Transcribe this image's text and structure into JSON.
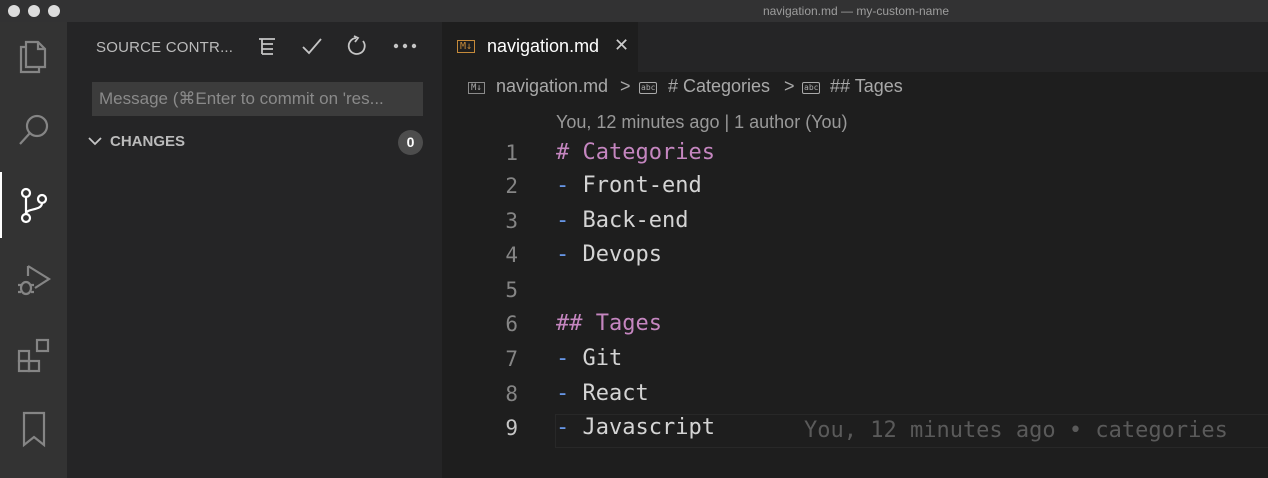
{
  "window": {
    "title": "navigation.md — my-custom-name"
  },
  "activity_bar": {
    "items": [
      {
        "icon": "files-icon"
      },
      {
        "icon": "search-icon"
      },
      {
        "icon": "source-control-icon",
        "active": true
      },
      {
        "icon": "run-debug-icon"
      },
      {
        "icon": "extensions-icon"
      },
      {
        "icon": "bookmark-icon"
      }
    ]
  },
  "sidebar": {
    "header": "SOURCE CONTR...",
    "actions": [
      "view-as-tree-icon",
      "commit-check-icon",
      "refresh-icon",
      "more-icon"
    ],
    "commit_placeholder": "Message (⌘Enter to commit on 'res...",
    "changes_label": "CHANGES",
    "changes_count": "0"
  },
  "tabs": [
    {
      "icon_text": "M↓",
      "label": "navigation.md",
      "close": "✕",
      "active": true
    }
  ],
  "breadcrumb": {
    "file_icon": "M↓",
    "file": "navigation.md",
    "sep": ">",
    "symbol_icon": "abc",
    "items": [
      "# Categories",
      "## Tages"
    ]
  },
  "editor": {
    "codelens": "You, 12 minutes ago | 1 author (You)",
    "lines": [
      {
        "n": "1",
        "prefix": "# ",
        "text": "Categories",
        "kind": "heading"
      },
      {
        "n": "2",
        "prefix": "- ",
        "text": "Front-end",
        "kind": "item"
      },
      {
        "n": "3",
        "prefix": "- ",
        "text": "Back-end",
        "kind": "item"
      },
      {
        "n": "4",
        "prefix": "- ",
        "text": "Devops",
        "kind": "item"
      },
      {
        "n": "5",
        "prefix": "",
        "text": "",
        "kind": "blank"
      },
      {
        "n": "6",
        "prefix": "## ",
        "text": "Tages",
        "kind": "heading"
      },
      {
        "n": "7",
        "prefix": "- ",
        "text": "Git",
        "kind": "item"
      },
      {
        "n": "8",
        "prefix": "- ",
        "text": "React",
        "kind": "item"
      },
      {
        "n": "9",
        "prefix": "- ",
        "text": "Javascript",
        "kind": "item"
      }
    ],
    "blame": "You, 12 minutes ago • categories"
  },
  "colors": {
    "heading": "#c586c0",
    "list_marker": "#6796e6",
    "text": "#d4d4d4"
  }
}
